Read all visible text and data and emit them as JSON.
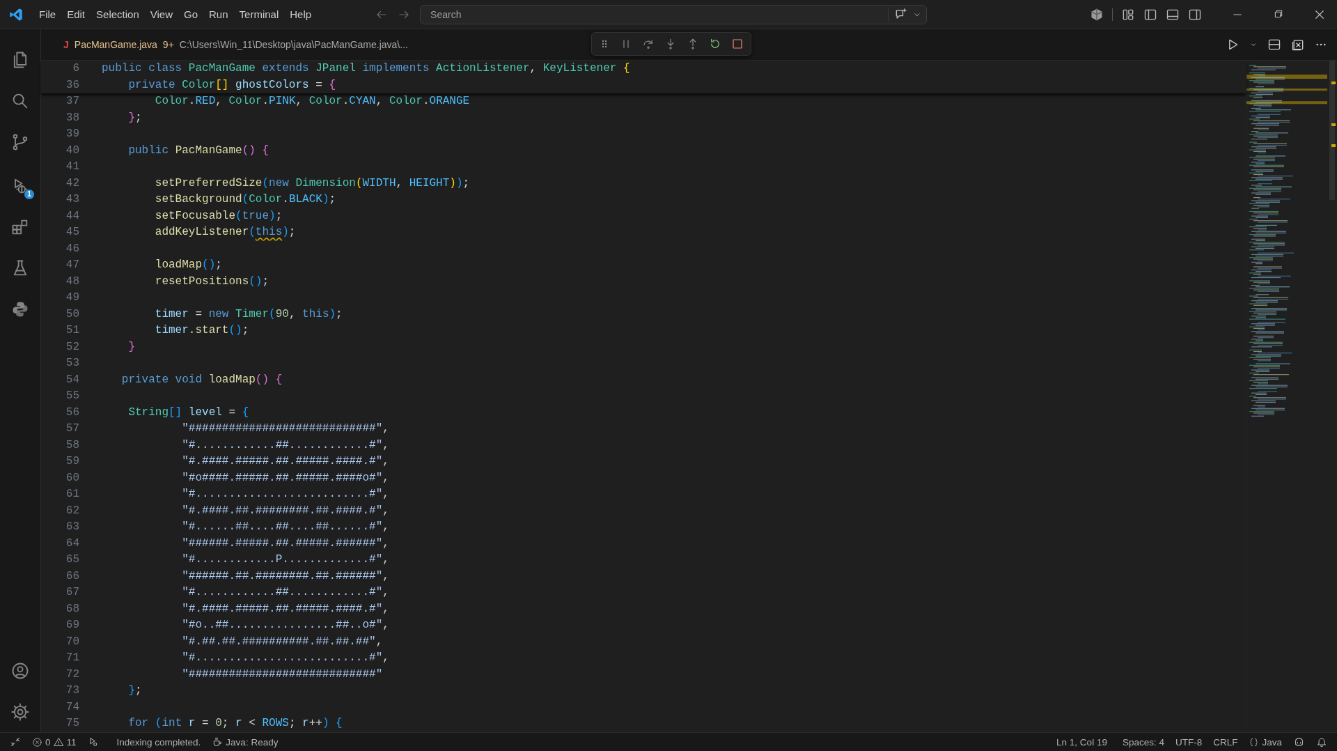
{
  "title_bar": {
    "menus": [
      "File",
      "Edit",
      "Selection",
      "View",
      "Go",
      "Run",
      "Terminal",
      "Help"
    ],
    "search": {
      "placeholder": "Search"
    }
  },
  "activity_bar": {
    "run_badge": "1"
  },
  "editor_tab": {
    "file_icon": "J",
    "filename": "PacManGame.java",
    "problems": "9+",
    "path": "C:\\Users\\Win_11\\Desktop\\java\\PacManGame.java\\..."
  },
  "code_lines": [
    {
      "number": "6",
      "sticky": true,
      "tokens": [
        {
          "text": "public class ",
          "kind": "keyword"
        },
        {
          "text": "PacManGame",
          "kind": "type"
        },
        {
          "text": " extends ",
          "kind": "keyword"
        },
        {
          "text": "JPanel",
          "kind": "type"
        },
        {
          "text": " implements ",
          "kind": "keyword"
        },
        {
          "text": "ActionListener",
          "kind": "type"
        },
        {
          "text": ", ",
          "kind": "plain"
        },
        {
          "text": "KeyListener ",
          "kind": "type"
        },
        {
          "text": "{",
          "kind": "bracket1"
        }
      ]
    },
    {
      "number": "36",
      "sticky": true,
      "tokens": [
        {
          "text": "    private ",
          "kind": "keyword"
        },
        {
          "text": "Color",
          "kind": "type"
        },
        {
          "text": "[]",
          "kind": "bracket1"
        },
        {
          "text": " ghostColors",
          "kind": "variable"
        },
        {
          "text": " = ",
          "kind": "plain"
        },
        {
          "text": "{",
          "kind": "bracket2"
        }
      ]
    },
    {
      "number": "37",
      "sticky": false,
      "tokens": [
        {
          "text": "        Color",
          "kind": "type"
        },
        {
          "text": ".",
          "kind": "plain"
        },
        {
          "text": "RED",
          "kind": "constant"
        },
        {
          "text": ", ",
          "kind": "plain"
        },
        {
          "text": "Color",
          "kind": "type"
        },
        {
          "text": ".",
          "kind": "plain"
        },
        {
          "text": "PINK",
          "kind": "constant"
        },
        {
          "text": ", ",
          "kind": "plain"
        },
        {
          "text": "Color",
          "kind": "type"
        },
        {
          "text": ".",
          "kind": "plain"
        },
        {
          "text": "CYAN",
          "kind": "constant"
        },
        {
          "text": ", ",
          "kind": "plain"
        },
        {
          "text": "Color",
          "kind": "type"
        },
        {
          "text": ".",
          "kind": "plain"
        },
        {
          "text": "ORANGE",
          "kind": "constant"
        }
      ]
    },
    {
      "number": "38",
      "sticky": false,
      "tokens": [
        {
          "text": "    }",
          "kind": "bracket2"
        },
        {
          "text": ";",
          "kind": "plain"
        }
      ]
    },
    {
      "number": "39",
      "sticky": false
    },
    {
      "number": "40",
      "sticky": false,
      "tokens": [
        {
          "text": "    public ",
          "kind": "keyword"
        },
        {
          "text": "PacManGame",
          "kind": "function"
        },
        {
          "text": "() ",
          "kind": "bracket2"
        },
        {
          "text": "{",
          "kind": "bracket2"
        }
      ]
    },
    {
      "number": "41",
      "sticky": false
    },
    {
      "number": "42",
      "sticky": false,
      "tokens": [
        {
          "text": "        setPreferredSize",
          "kind": "function"
        },
        {
          "text": "(",
          "kind": "bracket3"
        },
        {
          "text": "new ",
          "kind": "keyword"
        },
        {
          "text": "Dimension",
          "kind": "type"
        },
        {
          "text": "(",
          "kind": "bracket1"
        },
        {
          "text": "WIDTH",
          "kind": "constant"
        },
        {
          "text": ", ",
          "kind": "plain"
        },
        {
          "text": "HEIGHT",
          "kind": "constant"
        },
        {
          "text": ")",
          "kind": "bracket1"
        },
        {
          "text": ")",
          "kind": "bracket3"
        },
        {
          "text": ";",
          "kind": "plain"
        }
      ]
    },
    {
      "number": "43",
      "sticky": false,
      "tokens": [
        {
          "text": "        setBackground",
          "kind": "function"
        },
        {
          "text": "(",
          "kind": "bracket3"
        },
        {
          "text": "Color",
          "kind": "type"
        },
        {
          "text": ".",
          "kind": "plain"
        },
        {
          "text": "BLACK",
          "kind": "constant"
        },
        {
          "text": ")",
          "kind": "bracket3"
        },
        {
          "text": ";",
          "kind": "plain"
        }
      ]
    },
    {
      "number": "44",
      "sticky": false,
      "tokens": [
        {
          "text": "        setFocusable",
          "kind": "function"
        },
        {
          "text": "(",
          "kind": "bracket3"
        },
        {
          "text": "true",
          "kind": "keyword"
        },
        {
          "text": ")",
          "kind": "bracket3"
        },
        {
          "text": ";",
          "kind": "plain"
        }
      ]
    },
    {
      "number": "45",
      "sticky": false,
      "tokens": [
        {
          "text": "        addKeyListener",
          "kind": "function"
        },
        {
          "text": "(",
          "kind": "bracket3"
        },
        {
          "text": "this",
          "kind": "keyword",
          "warning": true
        },
        {
          "text": ")",
          "kind": "bracket3"
        },
        {
          "text": ";",
          "kind": "plain"
        }
      ]
    },
    {
      "number": "46",
      "sticky": false
    },
    {
      "number": "47",
      "sticky": false,
      "tokens": [
        {
          "text": "        loadMap",
          "kind": "function"
        },
        {
          "text": "()",
          "kind": "bracket3"
        },
        {
          "text": ";",
          "kind": "plain"
        }
      ]
    },
    {
      "number": "48",
      "sticky": false,
      "tokens": [
        {
          "text": "        resetPositions",
          "kind": "function"
        },
        {
          "text": "()",
          "kind": "bracket3"
        },
        {
          "text": ";",
          "kind": "plain"
        }
      ]
    },
    {
      "number": "49",
      "sticky": false
    },
    {
      "number": "50",
      "sticky": false,
      "tokens": [
        {
          "text": "        timer",
          "kind": "variable"
        },
        {
          "text": " = ",
          "kind": "plain"
        },
        {
          "text": "new ",
          "kind": "keyword"
        },
        {
          "text": "Timer",
          "kind": "type"
        },
        {
          "text": "(",
          "kind": "bracket3"
        },
        {
          "text": "90",
          "kind": "number"
        },
        {
          "text": ", ",
          "kind": "plain"
        },
        {
          "text": "this",
          "kind": "keyword"
        },
        {
          "text": ")",
          "kind": "bracket3"
        },
        {
          "text": ";",
          "kind": "plain"
        }
      ]
    },
    {
      "number": "51",
      "sticky": false,
      "tokens": [
        {
          "text": "        timer",
          "kind": "variable"
        },
        {
          "text": ".",
          "kind": "plain"
        },
        {
          "text": "start",
          "kind": "function"
        },
        {
          "text": "()",
          "kind": "bracket3"
        },
        {
          "text": ";",
          "kind": "plain"
        }
      ]
    },
    {
      "number": "52",
      "sticky": false,
      "tokens": [
        {
          "text": "    }",
          "kind": "bracket2"
        }
      ]
    },
    {
      "number": "53",
      "sticky": false
    },
    {
      "number": "54",
      "sticky": false,
      "tokens": [
        {
          "text": "   private void ",
          "kind": "keyword"
        },
        {
          "text": "loadMap",
          "kind": "function"
        },
        {
          "text": "() ",
          "kind": "bracket2"
        },
        {
          "text": "{",
          "kind": "bracket2"
        }
      ]
    },
    {
      "number": "55",
      "sticky": false
    },
    {
      "number": "56",
      "sticky": false,
      "tokens": [
        {
          "text": "    String",
          "kind": "type"
        },
        {
          "text": "[]",
          "kind": "bracket3"
        },
        {
          "text": " level",
          "kind": "variable"
        },
        {
          "text": " = ",
          "kind": "plain"
        },
        {
          "text": "{",
          "kind": "bracket3"
        }
      ]
    },
    {
      "number": "57",
      "sticky": false,
      "tokens": [
        {
          "text": "            \"############################\"",
          "kind": "string"
        },
        {
          "text": ",",
          "kind": "plain"
        }
      ]
    },
    {
      "number": "58",
      "sticky": false,
      "tokens": [
        {
          "text": "            \"#............##............#\"",
          "kind": "string"
        },
        {
          "text": ",",
          "kind": "plain"
        }
      ]
    },
    {
      "number": "59",
      "sticky": false,
      "tokens": [
        {
          "text": "            \"#.####.#####.##.#####.####.#\"",
          "kind": "string"
        },
        {
          "text": ",",
          "kind": "plain"
        }
      ]
    },
    {
      "number": "60",
      "sticky": false,
      "tokens": [
        {
          "text": "            \"#o####.#####.##.#####.####o#\"",
          "kind": "string"
        },
        {
          "text": ",",
          "kind": "plain"
        }
      ]
    },
    {
      "number": "61",
      "sticky": false,
      "tokens": [
        {
          "text": "            \"#..........................#\"",
          "kind": "string"
        },
        {
          "text": ",",
          "kind": "plain"
        }
      ]
    },
    {
      "number": "62",
      "sticky": false,
      "tokens": [
        {
          "text": "            \"#.####.##.########.##.####.#\"",
          "kind": "string"
        },
        {
          "text": ",",
          "kind": "plain"
        }
      ]
    },
    {
      "number": "63",
      "sticky": false,
      "tokens": [
        {
          "text": "            \"#......##....##....##......#\"",
          "kind": "string"
        },
        {
          "text": ",",
          "kind": "plain"
        }
      ]
    },
    {
      "number": "64",
      "sticky": false,
      "tokens": [
        {
          "text": "            \"######.#####.##.#####.######\"",
          "kind": "string"
        },
        {
          "text": ",",
          "kind": "plain"
        }
      ]
    },
    {
      "number": "65",
      "sticky": false,
      "tokens": [
        {
          "text": "            \"#............P.............#\"",
          "kind": "string"
        },
        {
          "text": ",",
          "kind": "plain"
        }
      ]
    },
    {
      "number": "66",
      "sticky": false,
      "tokens": [
        {
          "text": "            \"######.##.########.##.######\"",
          "kind": "string"
        },
        {
          "text": ",",
          "kind": "plain"
        }
      ]
    },
    {
      "number": "67",
      "sticky": false,
      "tokens": [
        {
          "text": "            \"#............##............#\"",
          "kind": "string"
        },
        {
          "text": ",",
          "kind": "plain"
        }
      ]
    },
    {
      "number": "68",
      "sticky": false,
      "tokens": [
        {
          "text": "            \"#.####.#####.##.#####.####.#\"",
          "kind": "string"
        },
        {
          "text": ",",
          "kind": "plain"
        }
      ]
    },
    {
      "number": "69",
      "sticky": false,
      "tokens": [
        {
          "text": "            \"#o..##................##..o#\"",
          "kind": "string"
        },
        {
          "text": ",",
          "kind": "plain"
        }
      ]
    },
    {
      "number": "70",
      "sticky": false,
      "tokens": [
        {
          "text": "            \"#.##.##.##########.##.##.##\"",
          "kind": "string"
        },
        {
          "text": ",",
          "kind": "plain"
        }
      ]
    },
    {
      "number": "71",
      "sticky": false,
      "tokens": [
        {
          "text": "            \"#..........................#\"",
          "kind": "string"
        },
        {
          "text": ",",
          "kind": "plain"
        }
      ]
    },
    {
      "number": "72",
      "sticky": false,
      "tokens": [
        {
          "text": "            \"############################\"",
          "kind": "string"
        }
      ]
    },
    {
      "number": "73",
      "sticky": false,
      "tokens": [
        {
          "text": "    }",
          "kind": "bracket3"
        },
        {
          "text": ";",
          "kind": "plain"
        }
      ]
    },
    {
      "number": "74",
      "sticky": false
    },
    {
      "number": "75",
      "sticky": false,
      "tokens": [
        {
          "text": "    for ",
          "kind": "keyword"
        },
        {
          "text": "(",
          "kind": "bracket3"
        },
        {
          "text": "int ",
          "kind": "keyword"
        },
        {
          "text": "r",
          "kind": "variable"
        },
        {
          "text": " = ",
          "kind": "plain"
        },
        {
          "text": "0",
          "kind": "number"
        },
        {
          "text": "; ",
          "kind": "plain"
        },
        {
          "text": "r",
          "kind": "variable"
        },
        {
          "text": " < ",
          "kind": "plain"
        },
        {
          "text": "ROWS",
          "kind": "constant"
        },
        {
          "text": "; ",
          "kind": "plain"
        },
        {
          "text": "r",
          "kind": "variable"
        },
        {
          "text": "++",
          "kind": "plain"
        },
        {
          "text": ") ",
          "kind": "bracket3"
        },
        {
          "text": "{",
          "kind": "bracket3"
        }
      ]
    }
  ],
  "status_bar": {
    "errors": "0",
    "warnings": "11",
    "message": "Indexing completed.",
    "java_status": "Java: Ready",
    "position": "Ln 1, Col 19",
    "indentation": "Spaces: 4",
    "encoding": "UTF-8",
    "line_ending": "CRLF",
    "language": "Java"
  }
}
